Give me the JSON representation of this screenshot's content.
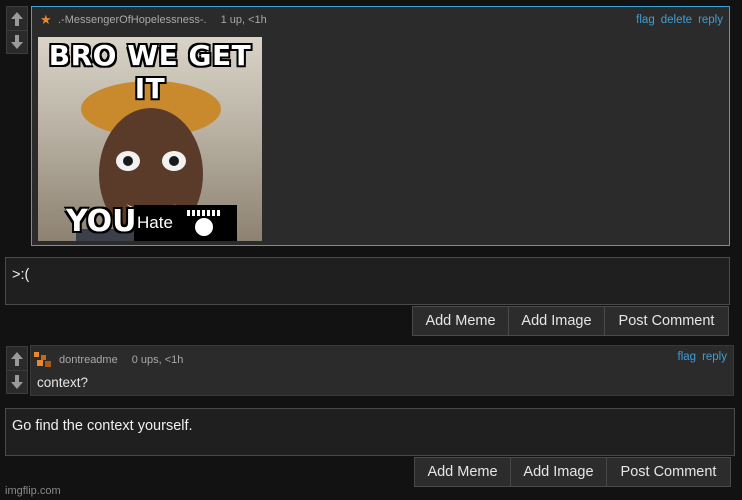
{
  "comments": [
    {
      "username": ".-MessengerOfHopelessness-.",
      "score": "1 up, <1h",
      "actions": [
        "flag",
        "delete",
        "reply"
      ],
      "meme": {
        "top_text": "BRO WE GET IT",
        "bottom_text": "YOU",
        "box_text": "Hate"
      }
    },
    {
      "username": "dontreadme",
      "score": "0 ups, <1h",
      "actions": [
        "flag",
        "reply"
      ],
      "text": "context?"
    }
  ],
  "reply_boxes": [
    {
      "value": ">:("
    },
    {
      "value": "Go find the context yourself."
    }
  ],
  "buttons": {
    "add_meme": "Add Meme",
    "add_image": "Add Image",
    "post_comment": "Post Comment"
  },
  "watermark": "imgflip.com",
  "colors": {
    "link": "#3c9fd8",
    "accent_border": "#3aa3d6",
    "star": "#e8892d"
  }
}
